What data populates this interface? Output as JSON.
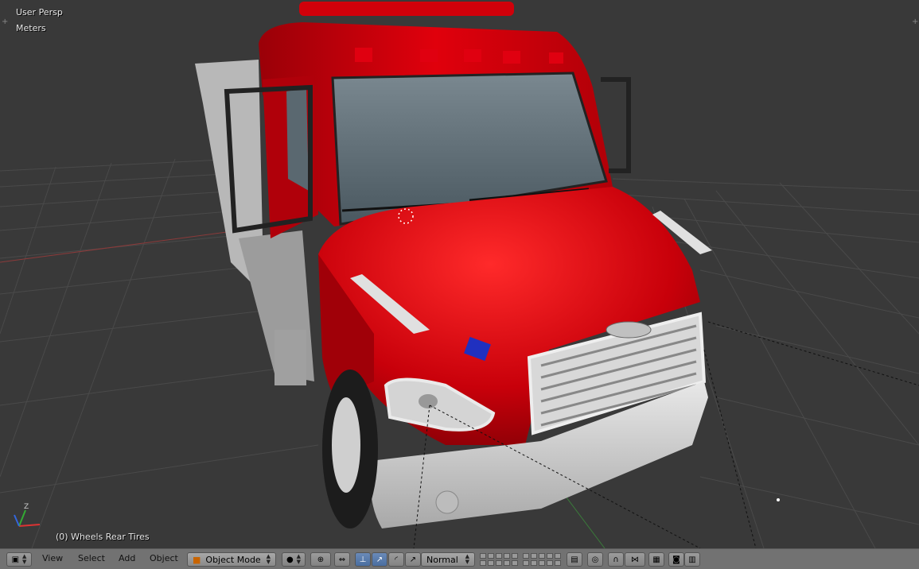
{
  "viewport": {
    "view_name": "User Persp",
    "units": "Meters",
    "selection": "(0) Wheels Rear Tires",
    "corner_plus": "+"
  },
  "header": {
    "menus": [
      "View",
      "Select",
      "Add",
      "Object"
    ],
    "mode": "Object Mode",
    "pivot": "Normal",
    "up_down": "▲\n▼"
  },
  "icons": {
    "editor_type": "cube-icon",
    "shading": "sphere-icon",
    "pivot_point": "crosshair-icon",
    "manipulator": "axis-icon",
    "snap": "magnet-icon",
    "render": "camera-icon"
  },
  "colors": {
    "viewport_bg": "#393939",
    "truck_red": "#c8000a",
    "header_bg": "#727272",
    "active_icon": "#4a6ea0"
  }
}
